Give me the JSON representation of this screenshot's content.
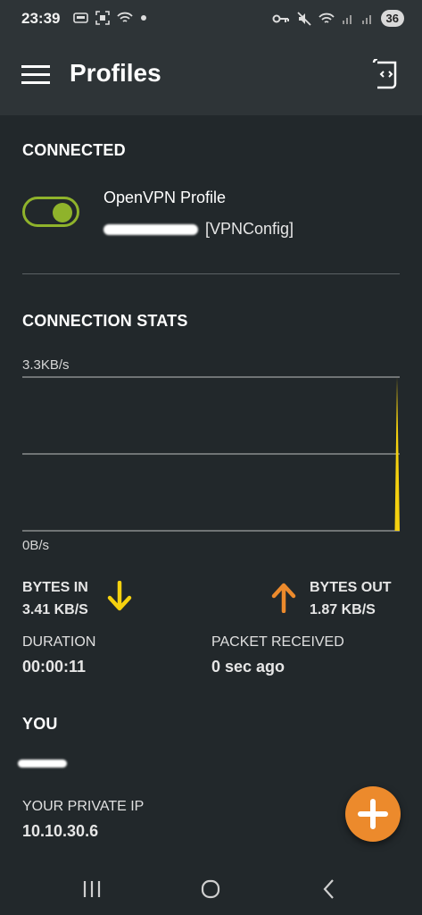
{
  "status_bar": {
    "time": "23:39",
    "battery": "36",
    "left_icons": [
      "notification-icon",
      "screenshot-icon",
      "wifi-icon",
      "dot-icon"
    ],
    "right_icons": [
      "vpn-key-icon",
      "mute-icon",
      "wifi-icon",
      "signal-icon",
      "signal-icon"
    ]
  },
  "app_bar": {
    "title": "Profiles",
    "menu_icon": "hamburger-menu-icon",
    "import_icon": "import-profile-icon"
  },
  "connected": {
    "heading": "CONNECTED",
    "toggle_on": true,
    "profile_name": "OpenVPN Profile",
    "profile_sub": "[VPNConfig]",
    "accent": "#8fb32b"
  },
  "stats": {
    "heading": "CONNECTION STATS",
    "chart_max_label": "3.3KB/s",
    "chart_min_label": "0B/s",
    "bytes_in_label": "BYTES IN",
    "bytes_in_value": "3.41 KB/S",
    "bytes_out_label": "BYTES OUT",
    "bytes_out_value": "1.87 KB/S",
    "duration_label": "DURATION",
    "duration_value": "00:00:11",
    "packet_label": "PACKET RECEIVED",
    "packet_value": "0 sec ago",
    "in_color": "#f5d10f",
    "out_color": "#ec8a2c"
  },
  "chart_data": {
    "type": "area",
    "ylim": [
      0,
      3.3
    ],
    "series": [
      {
        "values": [
          0,
          0,
          0,
          0,
          0,
          0,
          0,
          0,
          0,
          0,
          3.3
        ]
      }
    ]
  },
  "you": {
    "heading": "YOU",
    "private_ip_label": "YOUR PRIVATE IP",
    "private_ip_value": "10.10.30.6"
  },
  "fab": {
    "icon": "plus-icon",
    "color": "#ec8a2c"
  },
  "nav_bar": {
    "icons": [
      "recent-apps-icon",
      "home-icon",
      "back-icon"
    ]
  }
}
